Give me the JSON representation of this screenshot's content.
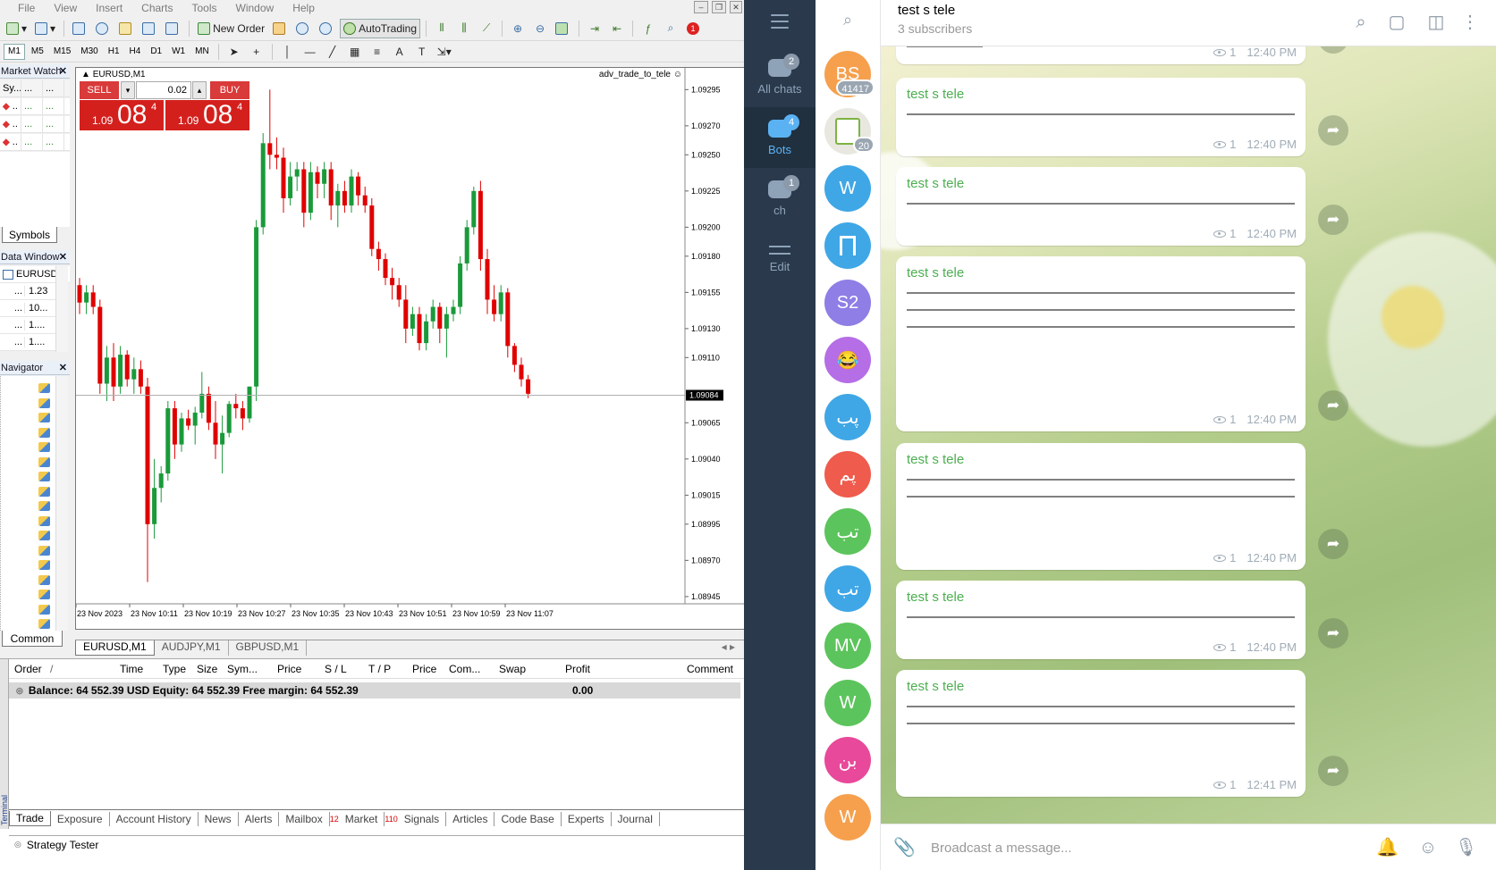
{
  "mt4": {
    "menu": [
      "File",
      "View",
      "Insert",
      "Charts",
      "Tools",
      "Window",
      "Help"
    ],
    "toolbar": {
      "new_order": "New Order",
      "autotrading": "AutoTrading"
    },
    "timeframes": [
      "M1",
      "M5",
      "M15",
      "M30",
      "H1",
      "H4",
      "D1",
      "W1",
      "MN"
    ],
    "market_watch": {
      "title": "Market Watch",
      "col1": "Sy...",
      "col2": "...",
      "col3": "...",
      "rows": [
        ".. ..",
        ".. ..",
        ".. .."
      ],
      "tab": "Symbols"
    },
    "data_window": {
      "title": "Data Window",
      "symbol": "EURUSD",
      "rows": [
        {
          "a": "...",
          "b": "1.23"
        },
        {
          "a": "...",
          "b": "10..."
        },
        {
          "a": "...",
          "b": "1...."
        },
        {
          "a": "...",
          "b": "1...."
        }
      ]
    },
    "navigator": {
      "title": "Navigator",
      "tab": "Common"
    },
    "chart": {
      "symbol": "EURUSD,M1",
      "ea_name": "adv_trade_to_tele",
      "sell_label": "SELL",
      "buy_label": "BUY",
      "lot": "0.02",
      "sell_price": {
        "prefix": "1.09",
        "big": "08",
        "sup": "4"
      },
      "buy_price": {
        "prefix": "1.09",
        "big": "08",
        "sup": "4"
      },
      "current_price": "1.09084",
      "price_ticks": [
        "1.09295",
        "1.09270",
        "1.09250",
        "1.09225",
        "1.09200",
        "1.09180",
        "1.09155",
        "1.09130",
        "1.09110",
        "1.09084",
        "1.09065",
        "1.09040",
        "1.09015",
        "1.08995",
        "1.08970",
        "1.08945"
      ],
      "time_ticks": [
        "23 Nov 2023",
        "23 Nov 10:11",
        "23 Nov 10:19",
        "23 Nov 10:27",
        "23 Nov 10:35",
        "23 Nov 10:43",
        "23 Nov 10:51",
        "23 Nov 10:59",
        "23 Nov 11:07"
      ],
      "tabs": [
        "EURUSD,M1",
        "AUDJPY,M1",
        "GBPUSD,M1"
      ]
    },
    "chart_data": {
      "type": "candlestick",
      "ylim": [
        1.0894,
        1.0931
      ],
      "current": 1.09084,
      "candles": [
        [
          1.0916,
          1.09165,
          1.0914,
          1.09148
        ],
        [
          1.09148,
          1.0916,
          1.0914,
          1.09155
        ],
        [
          1.09155,
          1.0916,
          1.0914,
          1.09145
        ],
        [
          1.09145,
          1.0915,
          1.09085,
          1.09092
        ],
        [
          1.09092,
          1.09118,
          1.0908,
          1.0911
        ],
        [
          1.0911,
          1.0912,
          1.0908,
          1.0909
        ],
        [
          1.0909,
          1.09118,
          1.09085,
          1.09112
        ],
        [
          1.09112,
          1.09115,
          1.0909,
          1.09095
        ],
        [
          1.09095,
          1.0911,
          1.09085,
          1.09102
        ],
        [
          1.09102,
          1.09108,
          1.09085,
          1.0909
        ],
        [
          1.0909,
          1.09096,
          1.08955,
          1.08995
        ],
        [
          1.08995,
          1.0904,
          1.08985,
          1.0902
        ],
        [
          1.0902,
          1.09035,
          1.0901,
          1.0903
        ],
        [
          1.0903,
          1.0908,
          1.09025,
          1.09075
        ],
        [
          1.09075,
          1.0908,
          1.0904,
          1.0905
        ],
        [
          1.0905,
          1.09072,
          1.09045,
          1.09068
        ],
        [
          1.09068,
          1.09074,
          1.0906,
          1.09063
        ],
        [
          1.09063,
          1.09076,
          1.0905,
          1.09072
        ],
        [
          1.09072,
          1.091,
          1.09068,
          1.09085
        ],
        [
          1.09085,
          1.0909,
          1.0906,
          1.09065
        ],
        [
          1.09065,
          1.0908,
          1.0904,
          1.0905
        ],
        [
          1.0905,
          1.0907,
          1.0903,
          1.09058
        ],
        [
          1.09058,
          1.0908,
          1.09055,
          1.09078
        ],
        [
          1.09078,
          1.09085,
          1.09068,
          1.09075
        ],
        [
          1.09075,
          1.0908,
          1.0906,
          1.09068
        ],
        [
          1.09068,
          1.0909,
          1.09065,
          1.0909
        ],
        [
          1.0909,
          1.09205,
          1.0908,
          1.092
        ],
        [
          1.092,
          1.09265,
          1.09195,
          1.09258
        ],
        [
          1.09258,
          1.09295,
          1.0924,
          1.0925
        ],
        [
          1.0925,
          1.09262,
          1.0924,
          1.09248
        ],
        [
          1.09248,
          1.09255,
          1.0921,
          1.0922
        ],
        [
          1.0922,
          1.09245,
          1.09215,
          1.09235
        ],
        [
          1.09235,
          1.09245,
          1.09225,
          1.0924
        ],
        [
          1.0924,
          1.09245,
          1.092,
          1.0921
        ],
        [
          1.0921,
          1.09245,
          1.09205,
          1.09238
        ],
        [
          1.09238,
          1.09242,
          1.0922,
          1.0923
        ],
        [
          1.0923,
          1.09245,
          1.0922,
          1.0924
        ],
        [
          1.0924,
          1.09245,
          1.09205,
          1.09215
        ],
        [
          1.09215,
          1.0923,
          1.092,
          1.09225
        ],
        [
          1.09225,
          1.09232,
          1.0921,
          1.09215
        ],
        [
          1.09215,
          1.0924,
          1.0921,
          1.09235
        ],
        [
          1.09235,
          1.09238,
          1.09215,
          1.09222
        ],
        [
          1.09222,
          1.09228,
          1.0921,
          1.09215
        ],
        [
          1.09215,
          1.0922,
          1.0918,
          1.09185
        ],
        [
          1.09185,
          1.0919,
          1.0917,
          1.09178
        ],
        [
          1.09178,
          1.09182,
          1.0916,
          1.09165
        ],
        [
          1.09165,
          1.09172,
          1.0915,
          1.0916
        ],
        [
          1.0916,
          1.09165,
          1.09145,
          1.0915
        ],
        [
          1.0915,
          1.0916,
          1.0912,
          1.0913
        ],
        [
          1.0913,
          1.09145,
          1.09125,
          1.0914
        ],
        [
          1.0914,
          1.09145,
          1.09115,
          1.0912
        ],
        [
          1.0912,
          1.0914,
          1.09115,
          1.09135
        ],
        [
          1.09135,
          1.0915,
          1.0913,
          1.09145
        ],
        [
          1.09145,
          1.09148,
          1.0912,
          1.0913
        ],
        [
          1.0913,
          1.09145,
          1.0911,
          1.0914
        ],
        [
          1.0914,
          1.0915,
          1.09135,
          1.09145
        ],
        [
          1.09145,
          1.0918,
          1.0914,
          1.09175
        ],
        [
          1.09175,
          1.09205,
          1.0917,
          1.092
        ],
        [
          1.092,
          1.09228,
          1.09195,
          1.09225
        ],
        [
          1.09225,
          1.09232,
          1.0917,
          1.09178
        ],
        [
          1.09178,
          1.09185,
          1.0914,
          1.0915
        ],
        [
          1.0915,
          1.0916,
          1.09135,
          1.0914
        ],
        [
          1.0914,
          1.0916,
          1.09135,
          1.09155
        ],
        [
          1.09155,
          1.09158,
          1.0911,
          1.09118
        ],
        [
          1.09118,
          1.0912,
          1.091,
          1.09105
        ],
        [
          1.09105,
          1.0911,
          1.0909,
          1.09095
        ],
        [
          1.09095,
          1.09098,
          1.09082,
          1.09085
        ]
      ]
    },
    "terminal": {
      "columns": [
        "Order",
        "/",
        "Time",
        "Type",
        "Size",
        "Sym...",
        "Price",
        "S / L",
        "T / P",
        "Price",
        "Com...",
        "Swap",
        "Profit",
        "Comment"
      ],
      "balance_text": "Balance: 64 552.39 USD  Equity: 64 552.39  Free margin: 64 552.39",
      "profit": "0.00",
      "tabs": [
        {
          "label": "Trade",
          "badge": ""
        },
        {
          "label": "Exposure",
          "badge": ""
        },
        {
          "label": "Account History",
          "badge": ""
        },
        {
          "label": "News",
          "badge": ""
        },
        {
          "label": "Alerts",
          "badge": ""
        },
        {
          "label": "Mailbox",
          "badge": "12"
        },
        {
          "label": "Market",
          "badge": "110"
        },
        {
          "label": "Signals",
          "badge": ""
        },
        {
          "label": "Articles",
          "badge": ""
        },
        {
          "label": "Code Base",
          "badge": ""
        },
        {
          "label": "Experts",
          "badge": ""
        },
        {
          "label": "Journal",
          "badge": ""
        }
      ],
      "vertical_label": "Terminal",
      "strategy_tester": "Strategy Tester"
    }
  },
  "telegram": {
    "rail": [
      {
        "label": "All chats",
        "badge": "2"
      },
      {
        "label": "Bots",
        "badge": "4"
      },
      {
        "label": "ch",
        "badge": "1"
      },
      {
        "label": "Edit",
        "badge": ""
      }
    ],
    "chats": [
      {
        "initials": "BS",
        "color": "#f6a04d",
        "badge": "41417"
      },
      {
        "initials": "",
        "color": "#e8e8e0",
        "badge": "20"
      },
      {
        "initials": "W",
        "color": "#3fa7e6",
        "badge": ""
      },
      {
        "initials": "",
        "color": "#3fa7e6",
        "badge": ""
      },
      {
        "initials": "S2",
        "color": "#8e7ee6",
        "badge": ""
      },
      {
        "initials": "😂",
        "color": "#b56ee6",
        "badge": ""
      },
      {
        "initials": "پب",
        "color": "#3fa7e6",
        "badge": ""
      },
      {
        "initials": "پم",
        "color": "#ef5b4c",
        "badge": ""
      },
      {
        "initials": "تب",
        "color": "#5cc45c",
        "badge": ""
      },
      {
        "initials": "تب",
        "color": "#3fa7e6",
        "badge": ""
      },
      {
        "initials": "MV",
        "color": "#5cc45c",
        "badge": ""
      },
      {
        "initials": "W",
        "color": "#5cc45c",
        "badge": ""
      },
      {
        "initials": "بن",
        "color": "#e8499a",
        "badge": ""
      },
      {
        "initials": "W",
        "color": "#f6a04d",
        "badge": ""
      }
    ],
    "header": {
      "title": "test s tele",
      "subtitle": "3 subscribers"
    },
    "messages": [
      {
        "author": "",
        "text": "——————",
        "views": "1",
        "time": "12:40 PM"
      },
      {
        "author": "test s tele",
        "text": "————————————————————————————————————————————————————————————————————————————————————————————————————————————————————————",
        "views": "1",
        "time": "12:40 PM"
      },
      {
        "author": "test s tele",
        "text": "————————————————————————————————————————————————————————————————————————————————————————————————————————————————————————",
        "views": "1",
        "time": "12:40 PM"
      },
      {
        "author": "test s tele",
        "text": "————————————————————————————————————————————————————————————————————————————————————————————————————————————————————————\n————————————————————————————————————————————————————————————————————————————————————————————————————————————————————————\n————————————————————————————————————————————————————————————————————————————————————————————————————————————————————————",
        "views": "1",
        "time": "12:40 PM"
      },
      {
        "author": "test s tele",
        "text": "————————————————————————————————————————————————————————————————————————————————————————————————————————————————————————\n————————————————————————————————————————————————————————————————————————————————————————————————————————————————————————",
        "views": "1",
        "time": "12:40 PM"
      },
      {
        "author": "test s tele",
        "text": "————————————————————————————————————————————————————————————————————————————————————————————————————————————————————————",
        "views": "1",
        "time": "12:40 PM"
      },
      {
        "author": "test s tele",
        "text": "————————————————————————————————————————————————————————————————————————————————————————————————————————————————————————\n————————————————————————————————————————————————————————————————————————————————————————————————————————————————————————",
        "views": "1",
        "time": "12:41 PM"
      }
    ],
    "composer_placeholder": "Broadcast a message..."
  }
}
